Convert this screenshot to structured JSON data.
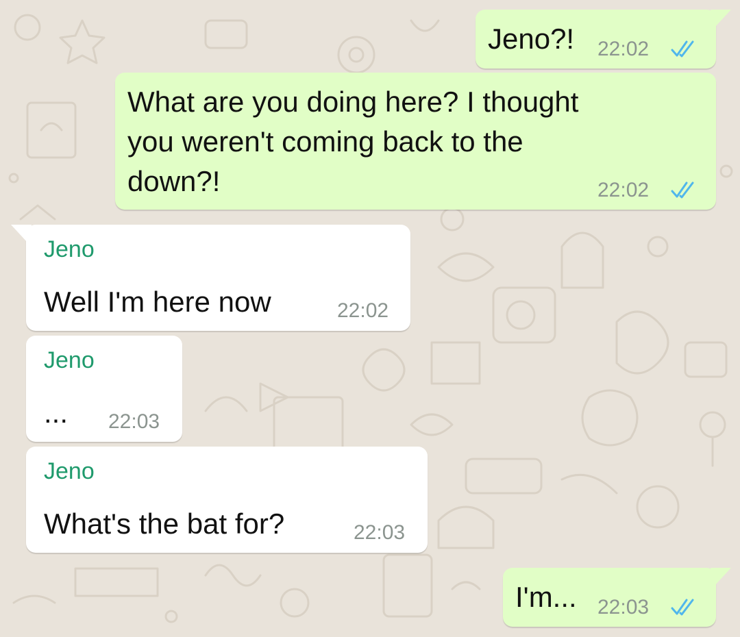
{
  "colors": {
    "outgoing_bubble": "#e1fec6",
    "incoming_bubble": "#ffffff",
    "sender_name": "#1f9a6c",
    "timestamp": "#8b948f",
    "read_ticks": "#4fb6ec",
    "wallpaper": "#e9e3da"
  },
  "messages": [
    {
      "direction": "outgoing",
      "text": "Jeno?!",
      "time": "22:02",
      "status_icon": "double-check-read-icon"
    },
    {
      "direction": "outgoing",
      "text_lines": [
        "What are you doing here? I thought",
        "you weren't coming back to the",
        "down?!"
      ],
      "time": "22:02",
      "status_icon": "double-check-read-icon"
    },
    {
      "direction": "incoming",
      "sender": "Jeno",
      "text": "Well I'm here now",
      "time": "22:02"
    },
    {
      "direction": "incoming",
      "sender": "Jeno",
      "text": "...",
      "time": "22:03"
    },
    {
      "direction": "incoming",
      "sender": "Jeno",
      "text": "What's the bat for?",
      "time": "22:03"
    },
    {
      "direction": "outgoing",
      "text": "I'm...",
      "time": "22:03",
      "status_icon": "double-check-read-icon"
    }
  ]
}
